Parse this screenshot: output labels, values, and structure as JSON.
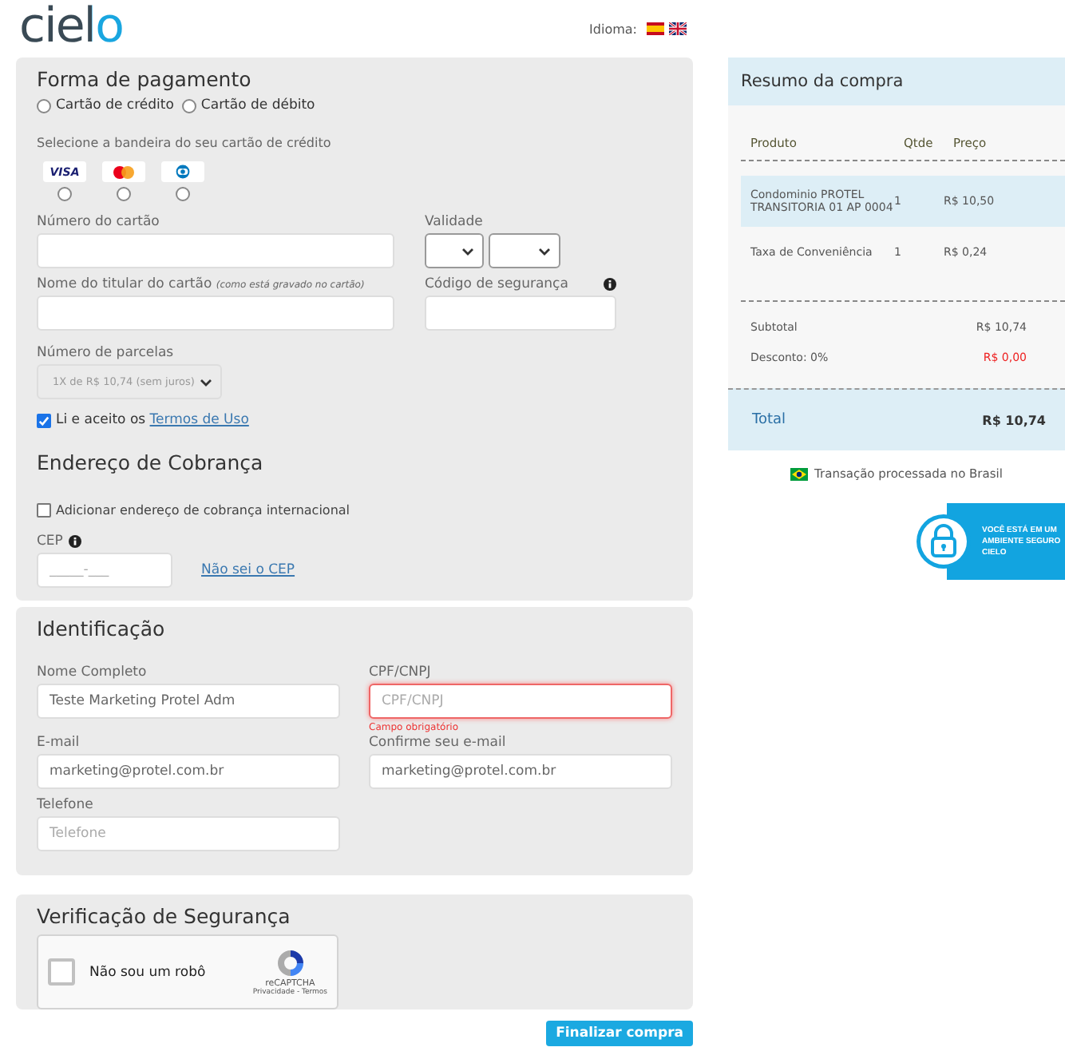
{
  "header": {
    "logo": "cielo",
    "language_label": "Idioma:",
    "languages": [
      {
        "kind": "es",
        "selected": false
      },
      {
        "kind": "en",
        "selected": false
      }
    ]
  },
  "payment": {
    "title": "Forma de pagamento",
    "methods": [
      {
        "label": "Cartão de crédito",
        "selected": false
      },
      {
        "label": "Cartão de débito",
        "selected": false
      }
    ],
    "brand_prompt": "Selecione a bandeira do seu cartão de crédito",
    "brands": [
      {
        "kind": "visa",
        "label": "VISA",
        "selected": false
      },
      {
        "kind": "mastercard",
        "selected": false
      },
      {
        "kind": "diners",
        "selected": false
      }
    ],
    "card_number": {
      "label": "Número do cartão"
    },
    "validity": {
      "label": "Validade"
    },
    "holder_name": {
      "label": "Nome do titular do cartão",
      "note": "(como está gravado no cartão)"
    },
    "security_code": {
      "label": "Código de segurança"
    },
    "installments": {
      "label": "Número de parcelas",
      "value": "1X de R$ 10,74 (sem juros)",
      "disabled": true
    },
    "terms": {
      "text": "Li e aceito os",
      "link": "Termos de Uso",
      "checked": true
    }
  },
  "billing": {
    "title": "Endereço de Cobrança",
    "international": {
      "label": "Adicionar endereço de cobrança internacional",
      "checked": false
    },
    "cep": {
      "label": "CEP",
      "placeholder": "_____-___"
    },
    "cep_link": "Não sei o CEP"
  },
  "identification": {
    "title": "Identificação",
    "fields": [
      {
        "label": "Nome Completo",
        "value": "Teste Marketing Protel Adm",
        "invalid": false
      },
      {
        "label": "CPF/CNPJ",
        "placeholder": "CPF/CNPJ",
        "invalid": true,
        "error": "Campo obrigatório"
      },
      {
        "label": "E-mail",
        "value": "marketing@protel.com.br",
        "invalid": false
      },
      {
        "label": "Confirme seu e-mail",
        "value": "marketing@protel.com.br",
        "invalid": false
      },
      {
        "label": "Telefone",
        "placeholder": "Telefone",
        "invalid": false
      }
    ]
  },
  "security": {
    "title": "Verificação de Segurança",
    "captcha": {
      "label": "Não sou um robô",
      "checked": false,
      "brand": "reCAPTCHA",
      "links": "Privacidade - Termos"
    }
  },
  "submit": "Finalizar compra",
  "summary": {
    "title": "Resumo da compra",
    "columns": [
      "Produto",
      "Qtde",
      "Preço"
    ],
    "rows": [
      {
        "product": "Condominio PROTEL TRANSITORIA 01 AP 0004",
        "qty": "1",
        "price": "R$ 10,50",
        "selected": true
      },
      {
        "product": "Taxa de Conveniência",
        "qty": "1",
        "price": "R$ 0,24",
        "selected": false
      }
    ],
    "subtotal": {
      "label": "Subtotal",
      "value": "R$ 10,74"
    },
    "discount": {
      "label": "Desconto: 0%",
      "value": "R$ 0,00"
    },
    "total": {
      "label": "Total",
      "value": "R$ 10,74"
    },
    "origin": "Transação processada no Brasil",
    "secure_badge": "VOCÊ ESTÁ EM UM AMBIENTE SEGURO CIELO"
  }
}
